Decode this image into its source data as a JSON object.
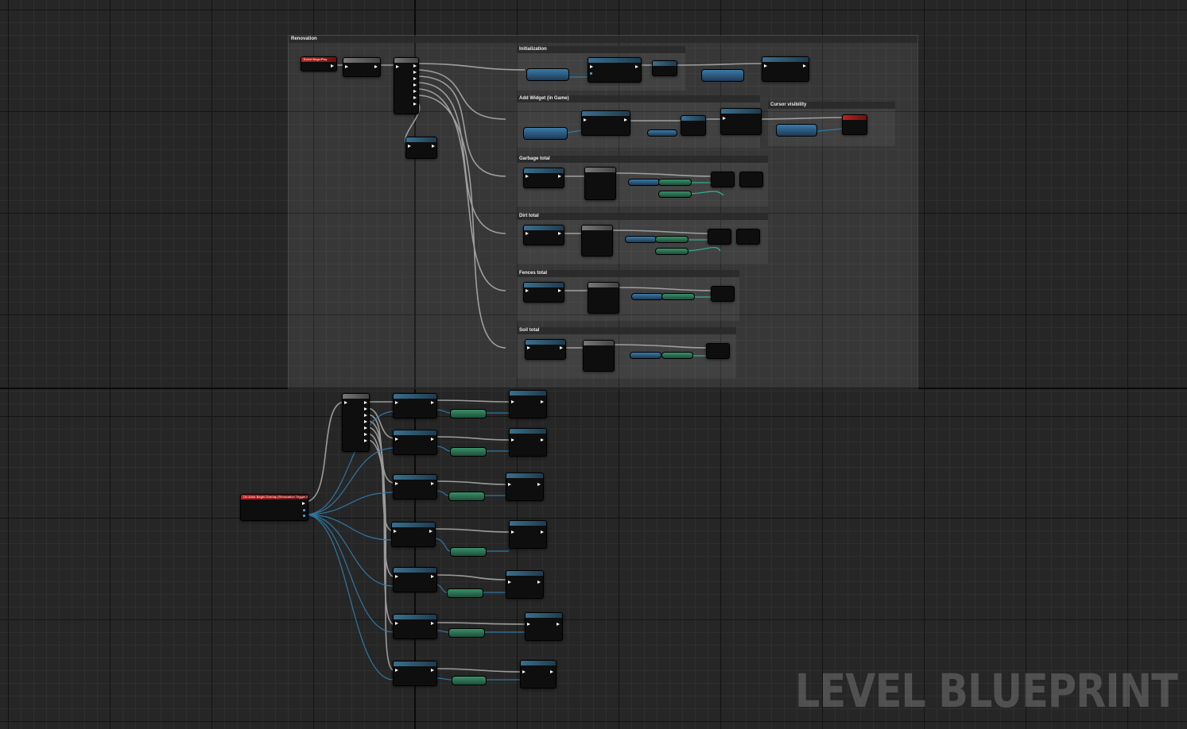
{
  "watermark": "LEVEL BLUEPRINT",
  "comments": {
    "main": "Renovation",
    "init": "Initialization",
    "add_widget": "Add Widget (in Game)",
    "cursor": "Cursor visibility",
    "garbage": "Garbage total",
    "dirt": "Dirt total",
    "fences": "Fences total",
    "soil": "Soil total"
  },
  "nodes": {
    "begin_play": "Event BeginPlay",
    "custom_event": "On Actor Begin Overlap (Renovation Trigger Box)"
  },
  "colors": {
    "exec_wire": "#b0b0b0",
    "data_wire": "#2f7fb0",
    "event_header": "#b22222",
    "function_header": "#3a6f8e"
  }
}
